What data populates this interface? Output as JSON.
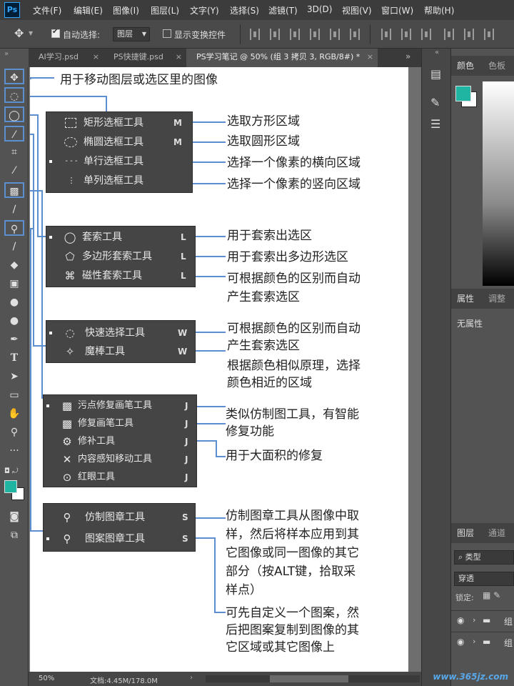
{
  "app": {
    "logo": "Ps"
  },
  "menu": [
    "文件(F)",
    "编辑(E)",
    "图像(I)",
    "图层(L)",
    "文字(Y)",
    "选择(S)",
    "滤镜(T)",
    "3D(D)",
    "视图(V)",
    "窗口(W)",
    "帮助(H)"
  ],
  "options": {
    "auto_select_label": "自动选择:",
    "auto_select_value": "图层",
    "auto_select_checked": true,
    "show_transform_label": "显示变换控件",
    "show_transform_checked": false
  },
  "tabs": [
    {
      "label": "AI学习.psd",
      "active": false
    },
    {
      "label": "PS快捷键.psd",
      "active": false
    },
    {
      "label": "PS学习笔记 @ 50% (组 3 拷贝 3, RGB/8#) *",
      "active": true
    }
  ],
  "status": {
    "zoom": "50%",
    "doc": "文档:4.45M/178.0M"
  },
  "panels": {
    "color_tabs": [
      "颜色",
      "色板"
    ],
    "props_tabs": [
      "属性",
      "调整"
    ],
    "props_text": "无属性",
    "layers_tabs": [
      "图层",
      "通道"
    ],
    "kind_label": "类型",
    "blend": "穿透",
    "lock_label": "锁定:",
    "layer_rows": [
      "组",
      "组"
    ]
  },
  "colors": {
    "foreground": "#1fb5a2",
    "background": "#ffffff",
    "accent_line": "#5b8fd0",
    "panel_dark": "#454545"
  },
  "doc": {
    "move_note": "用于移动图层或选区里的图像",
    "marquee_group": {
      "tools": [
        {
          "icon": "rect-marquee-icon",
          "label": "矩形选框工具",
          "key": "M"
        },
        {
          "icon": "ellipse-marquee-icon",
          "label": "椭圆选框工具",
          "key": "M"
        },
        {
          "icon": "single-row-marquee-icon",
          "label": "单行选框工具",
          "key": ""
        },
        {
          "icon": "single-column-marquee-icon",
          "label": "单列选框工具",
          "key": ""
        }
      ],
      "notes": [
        "选取方形区域",
        "选取圆形区域",
        "选择一个像素的横向区域",
        "选择一个像素的竖向区域"
      ]
    },
    "lasso_group": {
      "tools": [
        {
          "icon": "lasso-icon",
          "label": "套索工具",
          "key": "L"
        },
        {
          "icon": "polygon-lasso-icon",
          "label": "多边形套索工具",
          "key": "L"
        },
        {
          "icon": "magnetic-lasso-icon",
          "label": "磁性套索工具",
          "key": "L"
        }
      ],
      "notes": [
        "用于套索出选区",
        "用于套索出多边形选区",
        "可根据颜色的区别而自动",
        "产生套索选区"
      ]
    },
    "select_group": {
      "tools": [
        {
          "icon": "quick-select-icon",
          "label": "快速选择工具",
          "key": "W"
        },
        {
          "icon": "magic-wand-icon",
          "label": "魔棒工具",
          "key": "W"
        }
      ],
      "notes": [
        "可根据颜色的区别而自动",
        "产生套索选区",
        "根据颜色相似原理，选择",
        "颜色相近的区域"
      ]
    },
    "heal_group": {
      "tools": [
        {
          "icon": "spot-heal-icon",
          "label": "污点修复画笔工具",
          "key": "J"
        },
        {
          "icon": "heal-brush-icon",
          "label": "修复画笔工具",
          "key": "J"
        },
        {
          "icon": "patch-icon",
          "label": "修补工具",
          "key": "J"
        },
        {
          "icon": "content-move-icon",
          "label": "内容感知移动工具",
          "key": "J"
        },
        {
          "icon": "red-eye-icon",
          "label": "红眼工具",
          "key": "J"
        }
      ],
      "notes": [
        "类似仿制图工具，有智能",
        "修复功能",
        "用于大面积的修复"
      ]
    },
    "stamp_group": {
      "tools": [
        {
          "icon": "clone-stamp-icon",
          "label": "仿制图章工具",
          "key": "S"
        },
        {
          "icon": "pattern-stamp-icon",
          "label": "图案图章工具",
          "key": "S"
        }
      ],
      "notes": [
        "仿制图章工具从图像中取",
        "样，然后将样本应用到其",
        "它图像或同一图像的其它",
        "部分（按ALT键，拾取采",
        "样点）",
        "可先自定义一个图案，然",
        "后把图案复制到图像的其",
        "它区域或其它图像上"
      ]
    }
  },
  "watermark": "www.365jz.com"
}
